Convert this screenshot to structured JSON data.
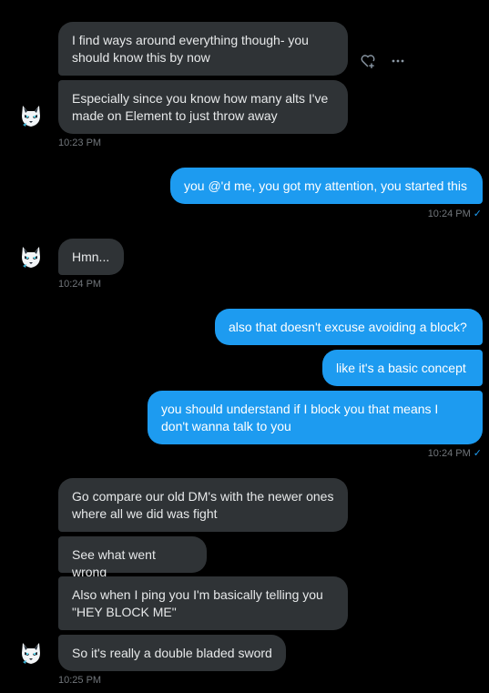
{
  "messages": [
    {
      "text": "I find ways around everything though- you\nshould know this by now"
    },
    {
      "text": "Especially since you know how many alts I've\nmade on Element to just throw away"
    },
    {
      "text": "you @'d me, you got my attention, you started this"
    },
    {
      "text": "Hmn..."
    },
    {
      "text": "also that doesn't excuse avoiding a block?"
    },
    {
      "text": "like it's a basic concept"
    },
    {
      "text": "you should understand if I block you that means I\ndon't wanna talk to you"
    },
    {
      "text": "Go compare our old DM's with the newer ones\nwhere all we did was fight"
    },
    {
      "text": "See what went wrong"
    },
    {
      "text": "Also when I ping you I'm basically telling you\n\"HEY BLOCK ME\""
    },
    {
      "text": "So it's really a double bladed sword"
    }
  ],
  "timestamps": {
    "t1": "10:23 PM",
    "t2": "10:24 PM",
    "t3": "10:24 PM",
    "t4": "10:24 PM",
    "t5": "10:25 PM"
  },
  "icons": {
    "react": "heart-plus-icon",
    "more": "more-icon",
    "seen": "checkmark-icon",
    "avatar": "husky-avatar"
  },
  "colors": {
    "background": "#000000",
    "received_bubble": "#2f3336",
    "sent_bubble": "#1d9bf0",
    "timestamp": "#71767b",
    "check": "#1d9bf0"
  }
}
